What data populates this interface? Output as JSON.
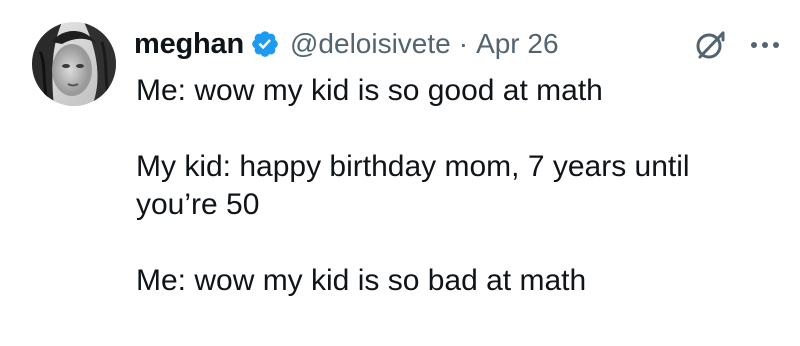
{
  "author": {
    "display_name": "meghan",
    "handle": "@deloisivete",
    "separator": "·",
    "date": "Apr 26",
    "verified_icon": "verified-badge-icon",
    "verified_color": "#1d9bf0",
    "avatar": "avatar"
  },
  "actions": {
    "grok_icon": "grok-icon",
    "more_icon": "more-options-icon"
  },
  "content": {
    "line1": "Me: wow my kid is so good at math",
    "line2": "My kid: happy birthday mom, 7 years until you’re 50",
    "line3": "Me: wow my kid is so bad at math"
  },
  "colors": {
    "text": "#0f1419",
    "secondary": "#536471"
  }
}
